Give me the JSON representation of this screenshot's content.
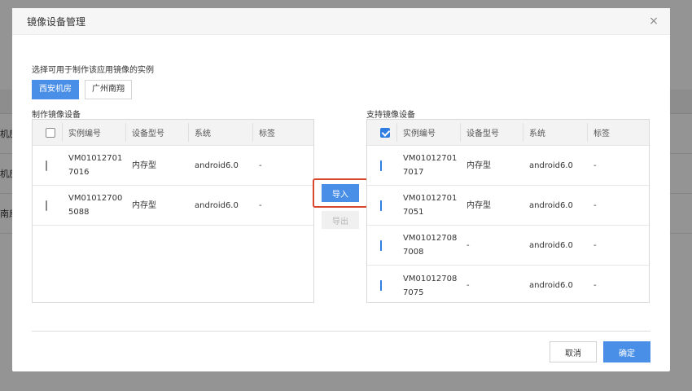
{
  "background": {
    "rows": [
      "机房",
      "机房",
      "南扇"
    ]
  },
  "modal": {
    "title": "镜像设备管理",
    "close_label": "×",
    "hint": "选择可用于制作该应用镜像的实例",
    "tabs": [
      {
        "label": "西安机房",
        "active": true
      },
      {
        "label": "广州南翔",
        "active": false
      }
    ],
    "left_panel": {
      "label": "制作镜像设备",
      "headers": [
        "实例编号",
        "设备型号",
        "系统",
        "标签"
      ],
      "rows": [
        {
          "id_line1": "VM01012701",
          "id_line2": "7016",
          "model": "内存型",
          "os": "android6.0",
          "tag": "-",
          "checked": false
        },
        {
          "id_line1": "VM01012700",
          "id_line2": "5088",
          "model": "内存型",
          "os": "android6.0",
          "tag": "-",
          "checked": false
        }
      ]
    },
    "right_panel": {
      "label": "支持镜像设备",
      "headers": [
        "实例编号",
        "设备型号",
        "系统",
        "标签"
      ],
      "rows": [
        {
          "id_line1": "VM01012701",
          "id_line2": "7017",
          "model": "内存型",
          "os": "android6.0",
          "tag": "-",
          "checked": true
        },
        {
          "id_line1": "VM01012701",
          "id_line2": "7051",
          "model": "内存型",
          "os": "android6.0",
          "tag": "-",
          "checked": true
        },
        {
          "id_line1": "VM01012708",
          "id_line2": "7008",
          "model": "-",
          "os": "android6.0",
          "tag": "-",
          "checked": true
        },
        {
          "id_line1": "VM01012708",
          "id_line2": "7075",
          "model": "-",
          "os": "android6.0",
          "tag": "-",
          "checked": true
        }
      ]
    },
    "import_label": "导入",
    "export_label": "导出",
    "cancel_label": "取消",
    "ok_label": "确定"
  },
  "colors": {
    "primary": "#4a8fe7",
    "highlight": "#d9482c",
    "checkbox_checked": "#2f7de1"
  }
}
